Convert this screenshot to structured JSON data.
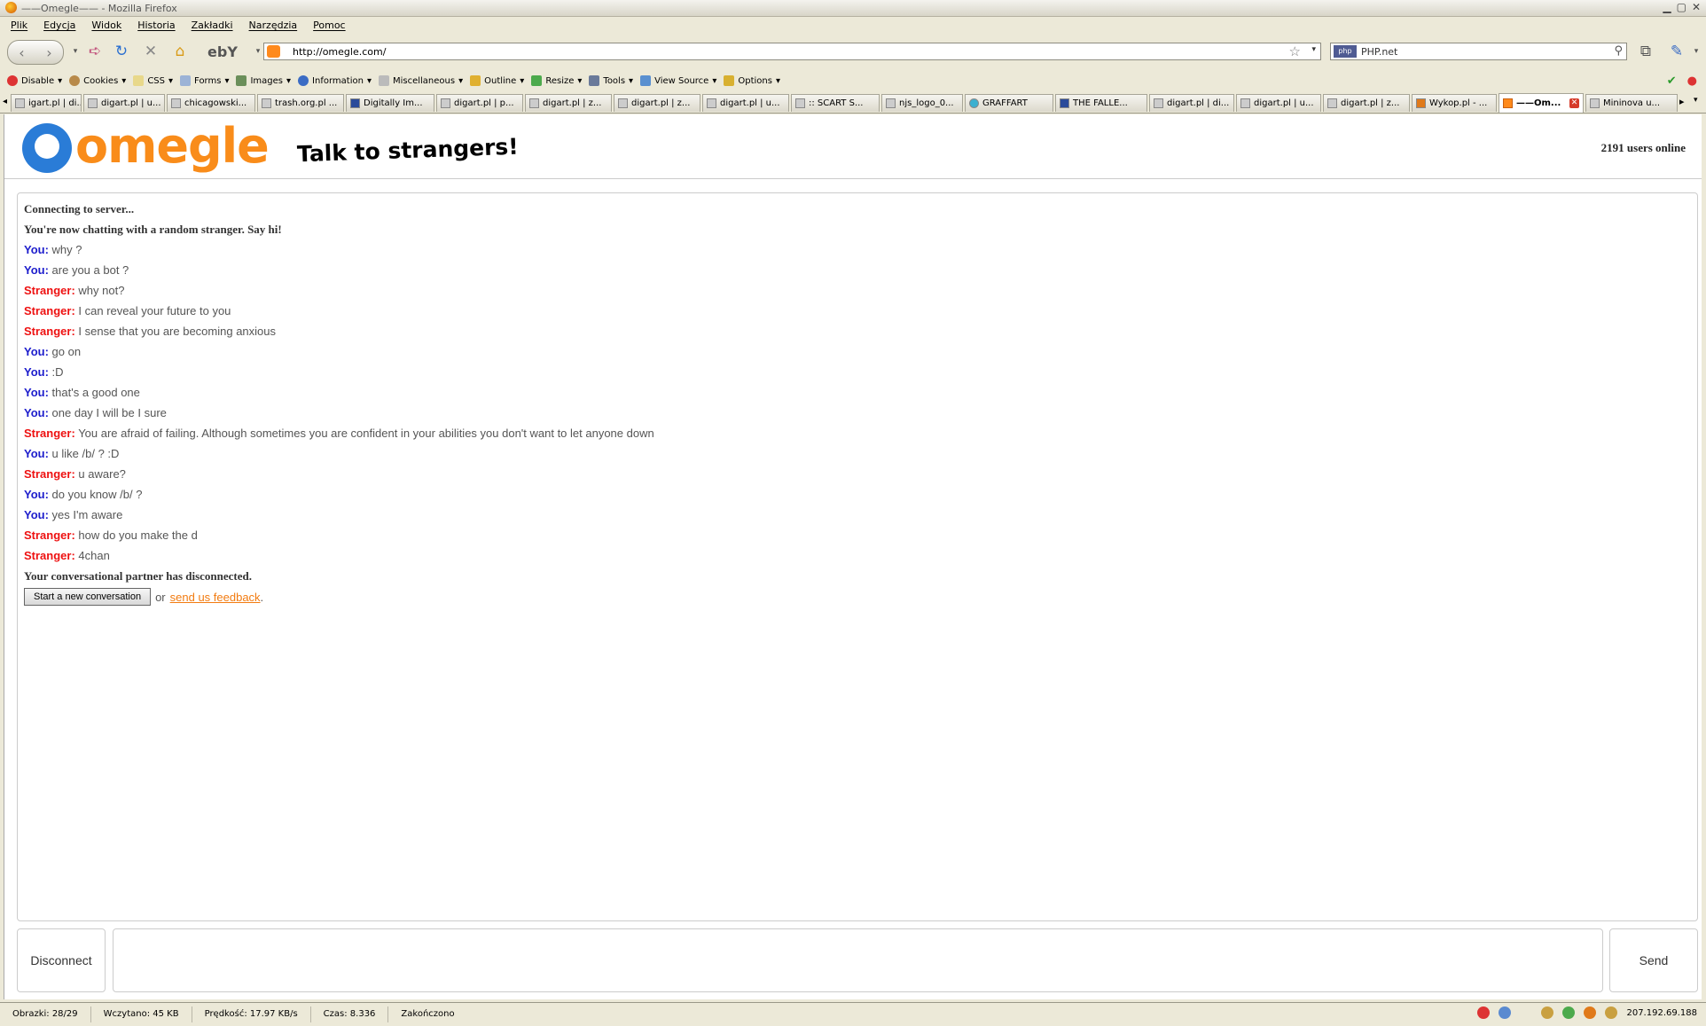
{
  "window": {
    "title": "——Omegle—— - Mozilla Firefox"
  },
  "menu": [
    "Plik",
    "Edycja",
    "Widok",
    "Historia",
    "Zakładki",
    "Narzędzia",
    "Pomoc"
  ],
  "nav": {
    "url": "http://omegle.com/",
    "search_engine": "php",
    "search_text": "PHP.net",
    "ebay_label": "ebY"
  },
  "devtools": [
    "Disable",
    "Cookies",
    "CSS",
    "Forms",
    "Images",
    "Information",
    "Miscellaneous",
    "Outline",
    "Resize",
    "Tools",
    "View Source",
    "Options"
  ],
  "tabs": [
    "igart.pl | di...",
    "digart.pl | u...",
    "chicagowski...",
    "trash.org.pl ...",
    "Digitally Im...",
    "digart.pl | p...",
    "digart.pl | z...",
    "digart.pl | z...",
    "digart.pl | u...",
    ":: SCART S...",
    "njs_logo_0...",
    "GRAFFART",
    "THE FALLE...",
    "digart.pl | di...",
    "digart.pl | u...",
    "digart.pl | z...",
    "Wykop.pl - ...",
    "——Om...",
    "Mininova u..."
  ],
  "page": {
    "logo": "omegle",
    "tagline": "Talk to strangers!",
    "online": "2191 users online",
    "chat": [
      {
        "type": "status",
        "text": "Connecting to server..."
      },
      {
        "type": "status",
        "text": "You're now chatting with a random stranger. Say hi!"
      },
      {
        "type": "you",
        "who": "You:",
        "text": "why ?"
      },
      {
        "type": "you",
        "who": "You:",
        "text": "are you a bot ?"
      },
      {
        "type": "stranger",
        "who": "Stranger:",
        "text": "why not?"
      },
      {
        "type": "stranger",
        "who": "Stranger:",
        "text": "I can reveal your future to you"
      },
      {
        "type": "stranger",
        "who": "Stranger:",
        "text": "I sense that you are becoming anxious"
      },
      {
        "type": "you",
        "who": "You:",
        "text": "go on"
      },
      {
        "type": "you",
        "who": "You:",
        "text": ":D"
      },
      {
        "type": "you",
        "who": "You:",
        "text": "that's a good one"
      },
      {
        "type": "you",
        "who": "You:",
        "text": "one day I will be I sure"
      },
      {
        "type": "stranger",
        "who": "Stranger:",
        "text": "You are afraid of failing. Although sometimes you are confident in your abilities you don't want to let anyone down"
      },
      {
        "type": "you",
        "who": "You:",
        "text": "u like /b/ ? :D"
      },
      {
        "type": "stranger",
        "who": "Stranger:",
        "text": "u aware?"
      },
      {
        "type": "you",
        "who": "You:",
        "text": "do you know /b/ ?"
      },
      {
        "type": "you",
        "who": "You:",
        "text": "yes I'm aware"
      },
      {
        "type": "stranger",
        "who": "Stranger:",
        "text": "how do you make the d"
      },
      {
        "type": "stranger",
        "who": "Stranger:",
        "text": "4chan"
      },
      {
        "type": "status",
        "text": "Your conversational partner has disconnected."
      }
    ],
    "new_conv_label": "Start a new conversation",
    "or_text": "or",
    "feedback_label": "send us feedback",
    "feedback_tail": ".",
    "disconnect_label": "Disconnect",
    "send_label": "Send",
    "message_value": ""
  },
  "status": {
    "images": "Obrazki: 28/29",
    "loaded": "Wczytano: 45 KB",
    "speed": "Prędkość: 17.97 KB/s",
    "time": "Czas: 8.336",
    "state": "Zakończono",
    "ip": "207.192.69.188"
  },
  "colors": {
    "you": "#1d1dcc",
    "stranger": "#ee1111",
    "logo_orange": "#f98c1a",
    "logo_blue": "#2a7cd7"
  }
}
